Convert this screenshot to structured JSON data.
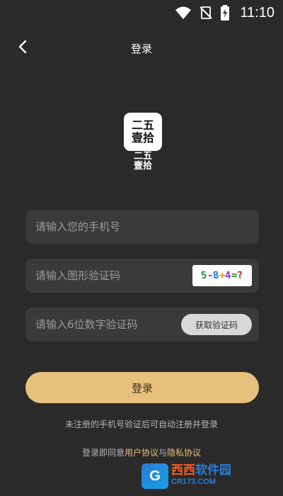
{
  "status_bar": {
    "time": "11:10",
    "icons": [
      "wifi-icon",
      "no-signal-icon",
      "battery-charging-icon"
    ]
  },
  "nav": {
    "back_icon": "chevron-left-icon",
    "title": "登录"
  },
  "logo": {
    "line1": "二五",
    "line2": "壹拾",
    "caption_line1": "二五",
    "caption_line2": "壹拾"
  },
  "form": {
    "phone_placeholder": "请输入您的手机号",
    "phone_value": "",
    "captcha_placeholder": "请输入图形验证码",
    "captcha_value": "",
    "captcha_image_text": "5-8+4=?",
    "sms_placeholder": "请输入6位数字验证码",
    "sms_value": "",
    "get_code_label": "获取验证码",
    "login_label": "登录"
  },
  "hint": "未注册的手机号验证后可自动注册并登录",
  "agreement": {
    "prefix": "登录即同意",
    "user_agreement": "用户协议",
    "and": "与",
    "privacy_agreement": "隐私协议"
  },
  "watermark": {
    "badge": "G",
    "title_part1": "西西",
    "title_part2": "软件园",
    "domain": "CR173.COM"
  },
  "colors": {
    "background": "#2b2a2a",
    "field": "#3a3a3a",
    "accent": "#e7c07d"
  }
}
